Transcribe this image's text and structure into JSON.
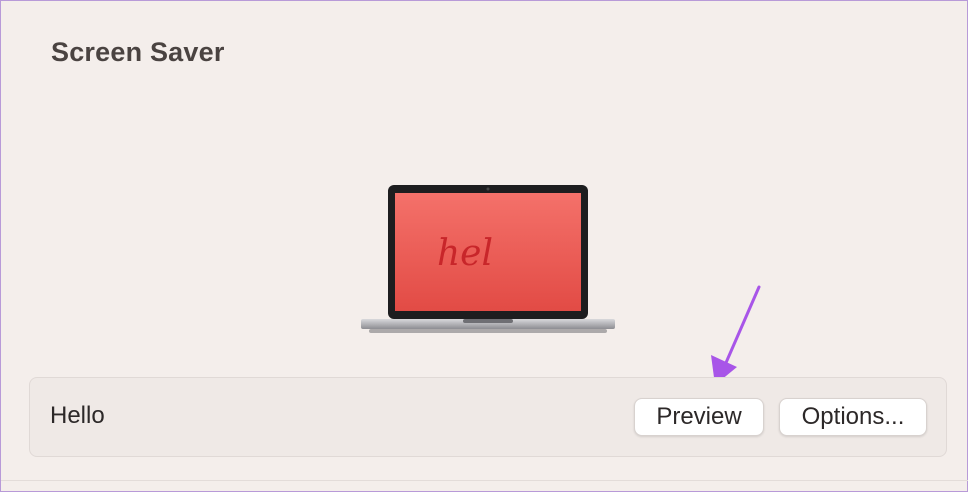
{
  "section": {
    "title": "Screen Saver"
  },
  "preview": {
    "screen_text": "hel",
    "icon": "laptop-preview-icon",
    "screen_color": "#ea5a52"
  },
  "row": {
    "label": "Hello",
    "preview_button": "Preview",
    "options_button": "Options..."
  },
  "annotation": {
    "icon": "arrow-pointer-icon",
    "color": "#a855e8"
  }
}
